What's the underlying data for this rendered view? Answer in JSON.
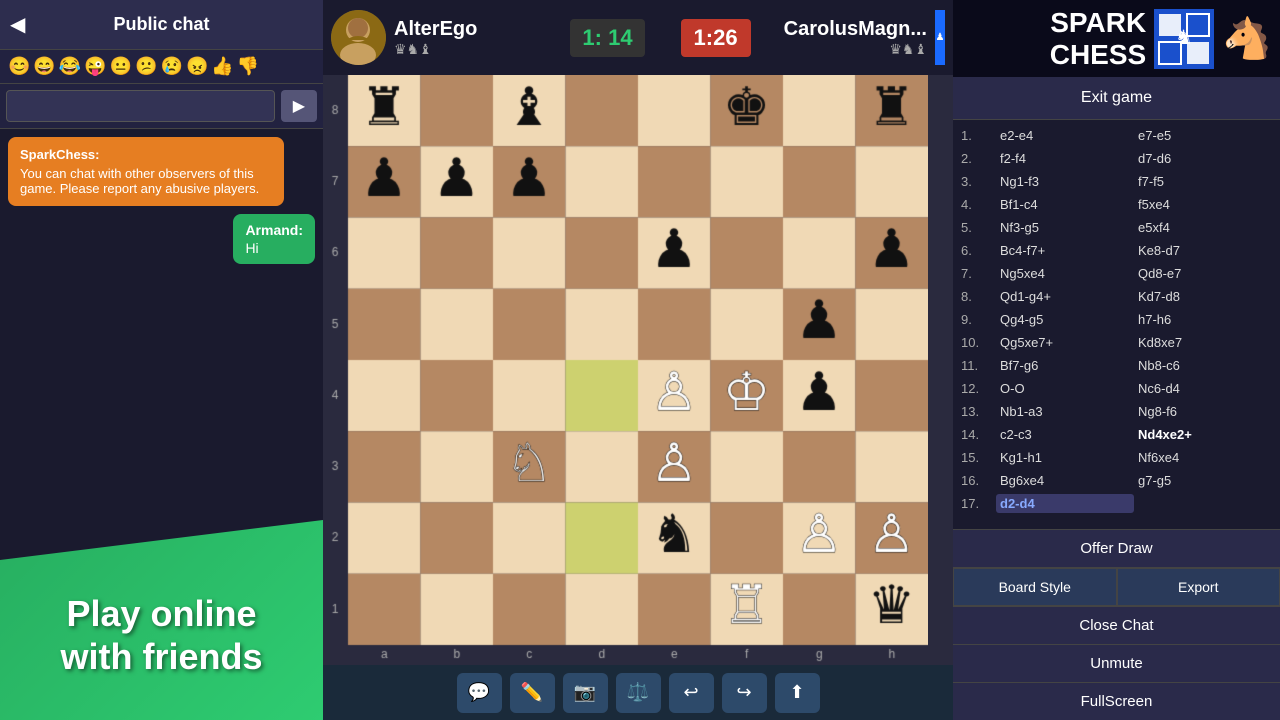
{
  "chat": {
    "title": "Public chat",
    "back_label": "◀",
    "send_label": "▶",
    "input_placeholder": "",
    "emojis": [
      "😊",
      "😄",
      "😂",
      "😜",
      "😐",
      "😕",
      "😢",
      "😠",
      "👍",
      "👎"
    ],
    "messages": [
      {
        "sender": "SparkChess:",
        "text": "You can chat with other observers of this game. Please report any abusive players.",
        "type": "system"
      },
      {
        "sender": "Armand:",
        "text": "Hi",
        "type": "user"
      }
    ]
  },
  "promo": {
    "line1": "Play online",
    "line2": "with friends"
  },
  "game": {
    "player_top": {
      "name": "AlterEgo",
      "timer": "1: 14",
      "timer_color": "green",
      "pieces": "♛♞♝"
    },
    "player_bottom": {
      "name": "CarolusMagn...",
      "timer": "1:26",
      "pieces": "♛♞♝"
    },
    "board": {
      "highlight_cells": [
        "d2",
        "d4"
      ]
    }
  },
  "moves": [
    {
      "num": "1.",
      "white": "e2-e4",
      "black": "e7-e5"
    },
    {
      "num": "2.",
      "white": "f2-f4",
      "black": "d7-d6"
    },
    {
      "num": "3.",
      "white": "Ng1-f3",
      "black": "f7-f5"
    },
    {
      "num": "4.",
      "white": "Bf1-c4",
      "black": "f5xe4"
    },
    {
      "num": "5.",
      "white": "Nf3-g5",
      "black": "e5xf4"
    },
    {
      "num": "6.",
      "white": "Bc4-f7+",
      "black": "Ke8-d7"
    },
    {
      "num": "7.",
      "white": "Ng5xe4",
      "black": "Qd8-e7"
    },
    {
      "num": "8.",
      "white": "Qd1-g4+",
      "black": "Kd7-d8"
    },
    {
      "num": "9.",
      "white": "Qg4-g5",
      "black": "h7-h6"
    },
    {
      "num": "10.",
      "white": "Qg5xe7+",
      "black": "Kd8xe7"
    },
    {
      "num": "11.",
      "white": "Bf7-g6",
      "black": "Nb8-c6"
    },
    {
      "num": "12.",
      "white": "O-O",
      "black": "Nc6-d4"
    },
    {
      "num": "13.",
      "white": "Nb1-a3",
      "black": "Ng8-f6"
    },
    {
      "num": "14.",
      "white": "c2-c3",
      "black": "Nd4xe2+"
    },
    {
      "num": "15.",
      "white": "Kg1-h1",
      "black": "Nf6xe4"
    },
    {
      "num": "16.",
      "white": "Bg6xe4",
      "black": "g7-g5"
    },
    {
      "num": "17.",
      "white": "d2-d4",
      "black": ""
    }
  ],
  "right_panel": {
    "logo_spark": "SPARK",
    "logo_chess": "CHESS",
    "exit_game": "Exit game",
    "offer_draw": "Offer Draw",
    "board_style": "Board Style",
    "export": "Export",
    "close_chat": "Close Chat",
    "unmute": "Unmute",
    "fullscreen": "FullScreen"
  },
  "toolbar": {
    "buttons": [
      "💬",
      "✏️",
      "📷",
      "⚖️",
      "↩",
      "↪",
      "⬆"
    ]
  }
}
